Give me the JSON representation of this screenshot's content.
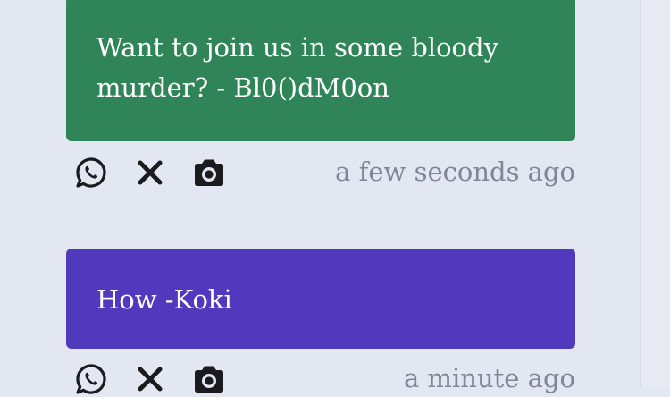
{
  "messages": [
    {
      "text": "Want to join us in some bloody murder? - Bl0()dM0on",
      "color": "#308558",
      "timestamp": "a few seconds ago",
      "actions": [
        "whatsapp-icon",
        "close-icon",
        "camera-icon"
      ]
    },
    {
      "text": "How -Koki",
      "color": "#5039bd",
      "timestamp": "a minute ago",
      "actions": [
        "whatsapp-icon",
        "close-icon",
        "camera-icon"
      ]
    }
  ]
}
